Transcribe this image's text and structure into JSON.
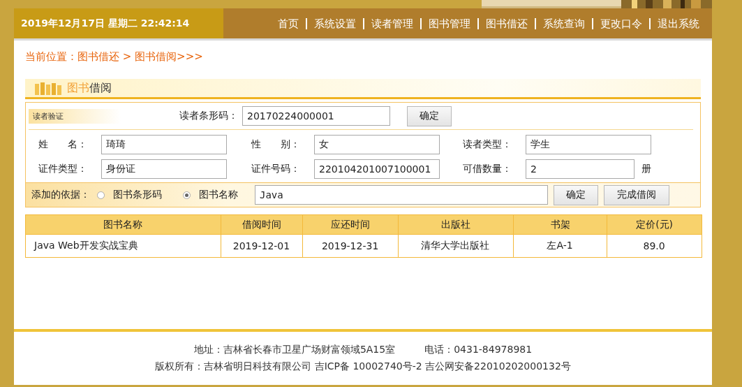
{
  "header": {
    "datetime": "2019年12月17日 星期二 22:42:14",
    "nav": [
      "首页",
      "系统设置",
      "读者管理",
      "图书管理",
      "图书借还",
      "系统查询",
      "更改口令",
      "退出系统"
    ]
  },
  "breadcrumb": "当前位置：图书借还 > 图书借阅>>>",
  "section_title": [
    {
      "text": "图书",
      "kind": "accent"
    },
    {
      "text": "借阅",
      "kind": "plain"
    }
  ],
  "reader_verify": {
    "badge": "读者验证",
    "label": "读者条形码：",
    "value": "20170224000001",
    "button": "确定"
  },
  "reader_info": [
    {
      "label": "姓　　名：",
      "value": "琦琦"
    },
    {
      "label": "性　　别：",
      "value": "女"
    },
    {
      "label": "读者类型：",
      "value": "学生"
    },
    {
      "label": "证件类型：",
      "value": "身份证"
    },
    {
      "label": "证件号码：",
      "value": "220104201007100001"
    },
    {
      "label": "可借数量：",
      "value": "2",
      "suffix": "册"
    }
  ],
  "add_by": {
    "label": "添加的依据：",
    "options": [
      {
        "label": "图书条形码",
        "selected": false
      },
      {
        "label": "图书名称",
        "selected": true
      }
    ],
    "value": "Java",
    "buttons": [
      "确定",
      "完成借阅"
    ]
  },
  "table": {
    "columns": [
      "图书名称",
      "借阅时间",
      "应还时间",
      "出版社",
      "书架",
      "定价(元)"
    ],
    "rows": [
      [
        "Java Web开发实战宝典",
        "2019-12-01",
        "2019-12-31",
        "清华大学出版社",
        "左A-1",
        "89.0"
      ]
    ]
  },
  "footer": [
    "地址：吉林省长春市卫星广场财富领域5A15室　　　电话：0431-84978981",
    "版权所有：吉林省明日科技有限公司 吉ICP备 10002740号-2 吉公网安备22010202000132号"
  ]
}
